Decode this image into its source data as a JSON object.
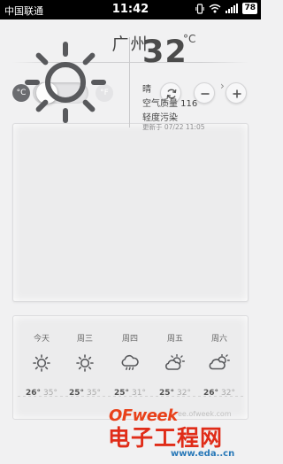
{
  "status_bar": {
    "carrier": "中国联通",
    "time": "11:42",
    "battery": "78",
    "icons": [
      "vibrate-icon",
      "wifi-icon",
      "signal-icon",
      "battery-icon"
    ]
  },
  "header": {
    "city": "广州"
  },
  "controls": {
    "celsius_label": "°C",
    "fahrenheit_label": "°F",
    "unit_selected": "celsius",
    "refresh_icon": "refresh-icon",
    "remove_icon": "minus-icon",
    "add_icon": "plus-icon"
  },
  "current": {
    "icon": "sun-icon",
    "temperature": "32",
    "unit": "°C",
    "condition": "晴",
    "air_quality": "空气质量 116",
    "pollution_level": "轻度污染",
    "updated": "更新于 07/22 11:05"
  },
  "forecast": [
    {
      "day": "今天",
      "icon": "sun-icon",
      "high": "26°",
      "low": "35°"
    },
    {
      "day": "周三",
      "icon": "sun-icon",
      "high": "25°",
      "low": "35°"
    },
    {
      "day": "周四",
      "icon": "rain-cloud-icon",
      "high": "25°",
      "low": "31°"
    },
    {
      "day": "周五",
      "icon": "sun-behind-cloud-icon",
      "high": "25°",
      "low": "32°"
    },
    {
      "day": "周六",
      "icon": "cloud-sun-icon",
      "high": "26°",
      "low": "32°"
    }
  ],
  "watermark": {
    "logo": "OFweek",
    "url1": "ee.ofweek.com",
    "title": "电子工程网",
    "url2": "www.eda..cn"
  },
  "colors": {
    "background": "#f1f1f2",
    "card": "#ececed",
    "icon_gray": "#5a5a5c",
    "watermark_red": "#e02c18",
    "watermark_blue": "#2878b8"
  }
}
